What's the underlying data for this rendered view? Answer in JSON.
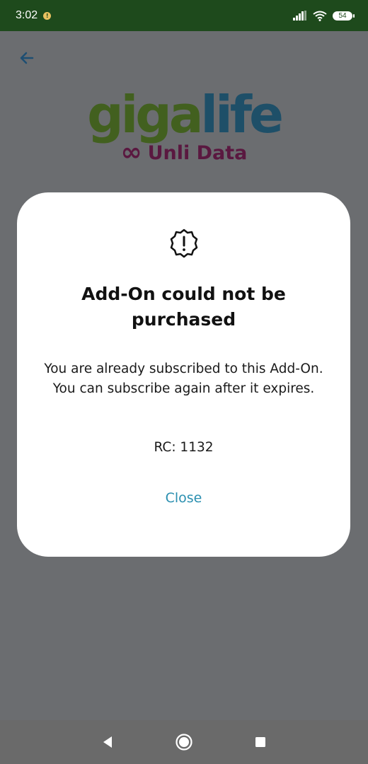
{
  "status_bar": {
    "time": "3:02",
    "notification_badge": "!",
    "battery": "54",
    "icons": [
      "signal-icon",
      "wifi-icon",
      "battery-icon"
    ]
  },
  "app": {
    "logo": {
      "main_part1": "giga",
      "main_part2": "life",
      "subtitle": "Unli Data",
      "infinity_symbol": "∞",
      "colors": {
        "giga": "#42601f",
        "life": "#1e4f68",
        "subtitle": "#5a1840"
      }
    }
  },
  "dialog": {
    "icon": "alert-badge-icon",
    "title": "Add-On could not be purchased",
    "message": "You are already subscribed to this Add-On. You can subscribe again after it expires.",
    "rc": "RC: 1132",
    "close_label": "Close",
    "accent_color": "#2a8fb0"
  },
  "nav_bar": {
    "buttons": [
      "back-icon",
      "home-icon",
      "recents-icon"
    ]
  }
}
